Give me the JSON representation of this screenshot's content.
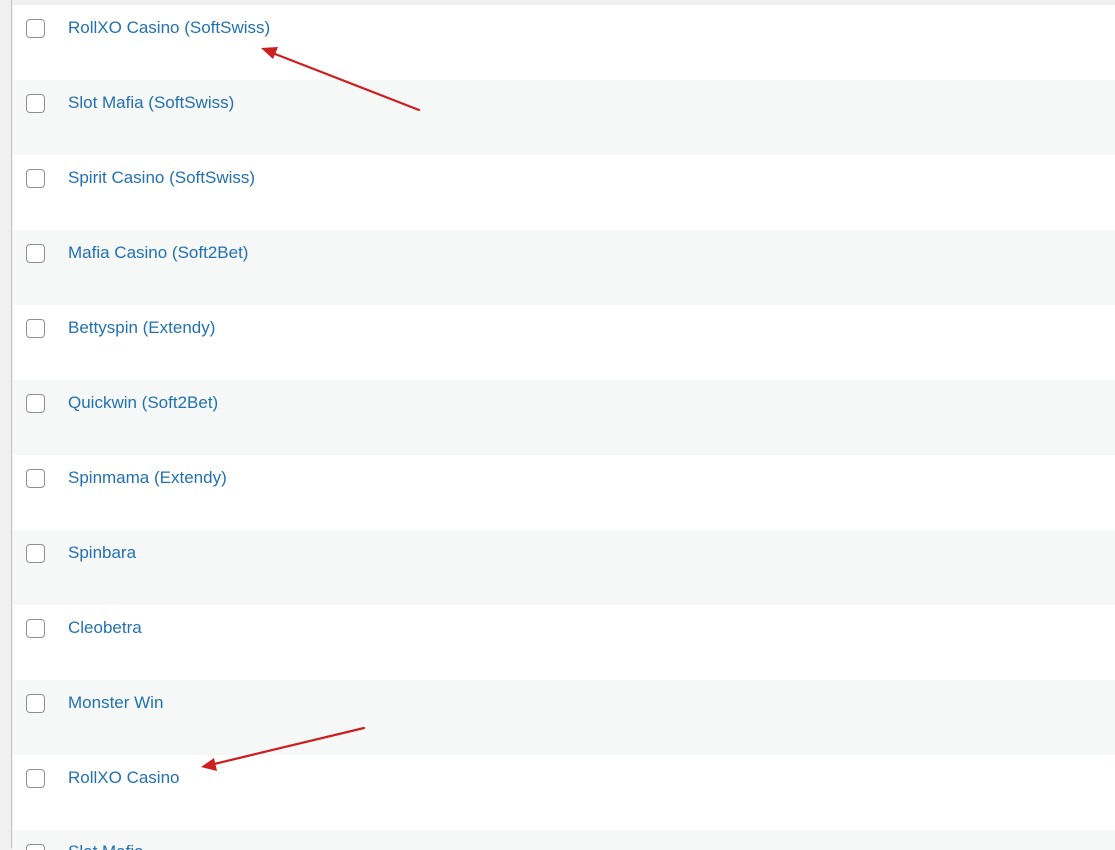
{
  "list": {
    "items": [
      {
        "label": "RollXO Casino (SoftSwiss)"
      },
      {
        "label": "Slot Mafia (SoftSwiss)"
      },
      {
        "label": "Spirit Casino (SoftSwiss)"
      },
      {
        "label": "Mafia Casino (Soft2Bet)"
      },
      {
        "label": "Bettyspin (Extendy)"
      },
      {
        "label": "Quickwin (Soft2Bet)"
      },
      {
        "label": "Spinmama (Extendy)"
      },
      {
        "label": "Spinbara"
      },
      {
        "label": "Cleobetra"
      },
      {
        "label": "Monster Win"
      },
      {
        "label": "RollXO Casino"
      },
      {
        "label": "Slot Mafia"
      }
    ]
  },
  "colors": {
    "link": "#2271b1",
    "row_alt": "#f6f7f7",
    "annotation_arrow": "#cc1f1f"
  }
}
